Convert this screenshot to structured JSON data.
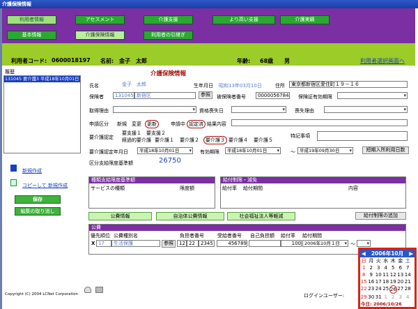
{
  "window": {
    "title": "介護保険情報"
  },
  "nav": {
    "row1": [
      "利用者情報",
      "アセスメント",
      "介護支援",
      "より高い支援",
      "介護実績"
    ],
    "row2": [
      "基本情報",
      "介護保険情報",
      "利用者の引継ぎ"
    ],
    "row1_selected": 0,
    "row2_selected": 1
  },
  "user": {
    "code_label": "利用者コード:",
    "code": "0600018197",
    "name_label": "名前:",
    "name": "金子　太郎",
    "age_label": "年齢:",
    "age": "68歳",
    "gender": "男",
    "link": "利用者選択画面へ"
  },
  "sidebar": {
    "history_label": "履歴",
    "history_item": "131045 要介護3 平成18年10月01日",
    "new_create": "新規作成",
    "copy_create": "コピーして 新規作成",
    "save": "保存",
    "cancel": "編集の取り消し"
  },
  "form": {
    "heading": "介護保険情報",
    "name_label": "氏名",
    "name_value": "金子　太郎",
    "dob_label": "生年月日",
    "dob_value": "昭和13年03月10日",
    "address_label": "住所",
    "address_value": "東京都新宿区愛住町１９－１６",
    "insurer_label": "保険者",
    "insurer_code": "131045",
    "insurer_name": "新宿区",
    "ref_btn": "参照",
    "insured_no_label": "被保険者番号",
    "insured_no": "0000056784",
    "validity_label": "保険証有効期限",
    "reason_label": "取得理由",
    "lose_date_label": "資格喪失日",
    "lose_reason_label": "喪失理由",
    "app_label": "申請区分",
    "app_new": "新規",
    "app_change": "変更",
    "app_renew": "更新",
    "app_during": "申請中",
    "app_cert": "認定済",
    "result_label": "結果内容",
    "care_level_label": "要介護認定",
    "levels_row1": [
      "要支援１",
      "要支援２"
    ],
    "levels_row2": [
      "経過的要介護",
      "要介護１",
      "要介護２",
      "要介護３",
      "要介護４",
      "要介護５"
    ],
    "special_label": "特記事項",
    "cert_date_label": "要介護認定年月日",
    "cert_date": "平成18年10月01日",
    "valid_period_label": "有効期限",
    "valid_from": "平成18年10月01日",
    "valid_sep": "～",
    "valid_to": "平成19年09月30日",
    "short_stay_btn": "短期入所利用日数",
    "limit_label": "区分支給限度基準額",
    "limit_value": "26750"
  },
  "tables": {
    "limit_title": "種類支給限度基準額",
    "limit_cols": [
      "サービスの種類",
      "限度額"
    ],
    "benefit_title": "給付制限・減免",
    "benefit_cols": [
      "給付率",
      "給付期間",
      "内容"
    ]
  },
  "tabs": [
    "公費情報",
    "自治体公費情報",
    "社会福祉法人等軽減"
  ],
  "add_limit_btn": "給付制限の追加",
  "public": {
    "title": "公費",
    "cols": [
      "優先順位",
      "公費種別名",
      "負担者番号",
      "受給者番号",
      "自己負担額",
      "給付率",
      "給付期間"
    ],
    "row": {
      "check": "X",
      "priority": "17",
      "type": "生活保護",
      "ref": "参照",
      "payer_a": "12",
      "payer_b": "22",
      "payer_c": "2345",
      "recipient": "456789",
      "self_pay": "",
      "rate": "100",
      "period_from": "2006年10月１日",
      "period_sep": "～"
    }
  },
  "calendar": {
    "month": "2006年10月",
    "weekdays": [
      "日",
      "月",
      "火",
      "水",
      "木",
      "金",
      "土"
    ],
    "days": [
      "1",
      "2",
      "3",
      "4",
      "5",
      "6",
      "7",
      "8",
      "9",
      "10",
      "11",
      "12",
      "13",
      "14",
      "15",
      "16",
      "17",
      "18",
      "19",
      "20",
      "21",
      "22",
      "23",
      "24",
      "25",
      "26",
      "27",
      "28",
      "29",
      "30",
      "31",
      "1",
      "2",
      "3",
      "4"
    ],
    "today_label": "今日: 2006/10/26",
    "today": "26"
  },
  "footer": {
    "copyright": "Copyright (C) 2004 LCNet Corporation",
    "login_label": "ログインユーザー:"
  },
  "colors": {
    "purple": "#7b2fa3",
    "green": "#2aa832",
    "lime": "#9ccc28"
  }
}
